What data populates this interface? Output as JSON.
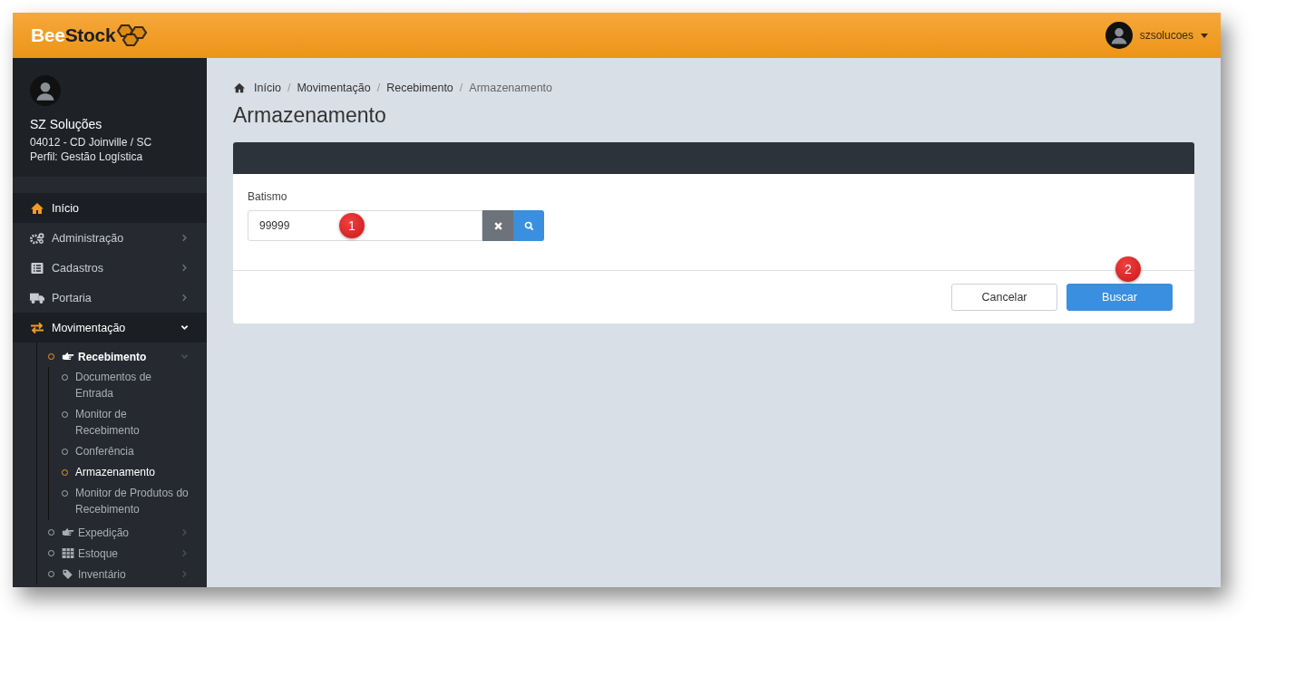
{
  "logo": {
    "first": "Bee",
    "second": "Stock"
  },
  "user_menu": {
    "username": "szsolucoes"
  },
  "profile": {
    "name": "SZ Soluções",
    "unit": "04012 - CD Joinville / SC",
    "role": "Perfil: Gestão Logística"
  },
  "menu": [
    {
      "label": "Início",
      "selected": true
    },
    {
      "label": "Administração",
      "selected": false,
      "expanded": false
    },
    {
      "label": "Cadastros",
      "selected": false,
      "expanded": false
    },
    {
      "label": "Portaria",
      "selected": false,
      "expanded": false
    },
    {
      "label": "Movimentação",
      "selected": true,
      "expanded": true,
      "children": [
        {
          "label": "Recebimento",
          "selected": true,
          "expanded": true,
          "children": [
            {
              "label": "Documentos de Entrada",
              "selected": false
            },
            {
              "label": "Monitor de Recebimento",
              "selected": false
            },
            {
              "label": "Conferência",
              "selected": false
            },
            {
              "label": "Armazenamento",
              "selected": true
            },
            {
              "label": "Monitor de Produtos do Recebimento",
              "selected": false
            }
          ]
        },
        {
          "label": "Expedição",
          "selected": false,
          "expanded": false
        },
        {
          "label": "Estoque",
          "selected": false,
          "expanded": false
        },
        {
          "label": "Inventário",
          "selected": false,
          "expanded": false
        }
      ]
    }
  ],
  "breadcrumb": [
    "Início",
    "Movimentação",
    "Recebimento",
    "Armazenamento"
  ],
  "breadcrumb_separator": "/",
  "page_title": "Armazenamento",
  "form": {
    "field_label": "Batismo",
    "field_value": "99999",
    "buttons": [
      {
        "label": "Cancelar",
        "kind": "secondary"
      },
      {
        "label": "Buscar",
        "kind": "primary"
      }
    ]
  },
  "callouts": [
    "1",
    "2"
  ]
}
